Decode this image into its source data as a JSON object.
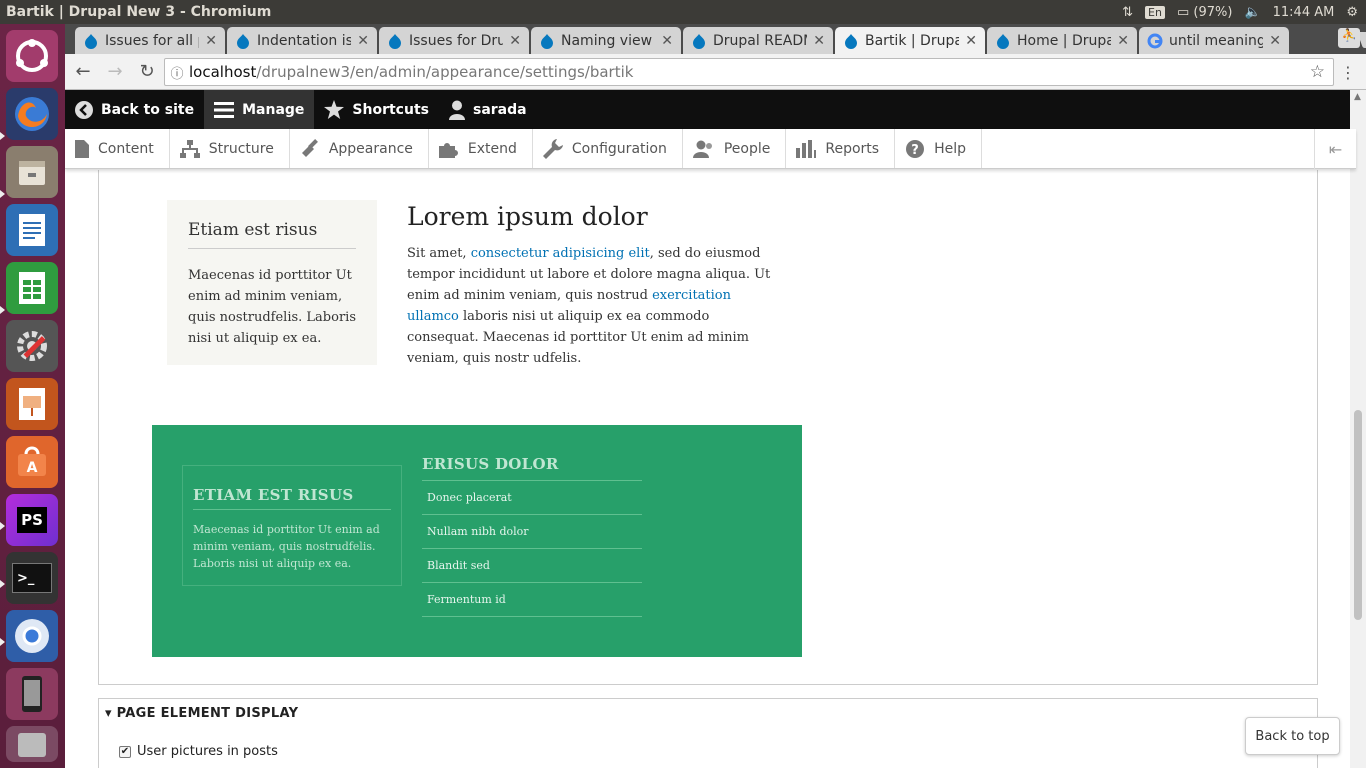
{
  "os_panel": {
    "window_title": "Bartik | Drupal New 3 - Chromium",
    "lang": "En",
    "battery": "(97%)",
    "time": "11:44 AM"
  },
  "launcher": {
    "apps": [
      "ubuntu-dash",
      "firefox",
      "files",
      "libreoffice-writer",
      "libreoffice-calc",
      "system-settings",
      "libreoffice-impress",
      "software-center",
      "phpstorm",
      "terminal",
      "chromium",
      "phone",
      "trash"
    ],
    "phpstorm_label": "PS",
    "terminal_label": ">_"
  },
  "tabs": [
    {
      "title": "Issues for all p",
      "icon": "drupal-icon"
    },
    {
      "title": "Indentation is",
      "icon": "drupal-icon"
    },
    {
      "title": "Issues for Dru",
      "icon": "drupal-icon"
    },
    {
      "title": "Naming view f",
      "icon": "drupal-icon"
    },
    {
      "title": "Drupal READM",
      "icon": "drupal-icon"
    },
    {
      "title": "Bartik | Drupal",
      "icon": "drupal-icon"
    },
    {
      "title": "Home | Drupal",
      "icon": "drupal-icon"
    },
    {
      "title": "until meaning",
      "icon": "google-icon"
    }
  ],
  "address": {
    "host": "localhost",
    "path": "/drupalnew3/en/admin/appearance/settings/bartik"
  },
  "admin_bar": {
    "back": "Back to site",
    "manage": "Manage",
    "shortcuts": "Shortcuts",
    "user": "sarada"
  },
  "admin_tray": [
    "Content",
    "Structure",
    "Appearance",
    "Extend",
    "Configuration",
    "People",
    "Reports",
    "Help"
  ],
  "preview": {
    "sidebar_title": "Etiam est risus",
    "sidebar_text": "Maecenas id porttitor Ut enim ad minim veniam, quis nostrudfelis. Laboris nisi ut aliquip ex ea.",
    "main_title": "Lorem ipsum dolor",
    "main_p1": "Sit amet, ",
    "main_link1": "consectetur adipisicing elit",
    "main_p2": ", sed do eiusmod tempor incididunt ut labore et dolore magna aliqua. Ut enim ad minim veniam, quis nostrud ",
    "main_link2": "exercitation ullamco",
    "main_p3": " laboris nisi ut aliquip ex ea commodo consequat. Maecenas id porttitor Ut enim ad minim veniam, quis nostr udfelis.",
    "footer_block1_title": "ETIAM EST RISUS",
    "footer_block1_text": "Maecenas id porttitor Ut enim ad minim veniam, quis nostrudfelis. Laboris nisi ut aliquip ex ea.",
    "footer_block2_title": "ERISUS DOLOR",
    "footer_links": [
      "Donec placerat",
      "Nullam nibh dolor",
      "Blandit sed",
      "Fermentum id"
    ],
    "footer_color": "#27a06a"
  },
  "fieldset": {
    "legend": "PAGE ELEMENT DISPLAY",
    "checkbox_label": "User pictures in posts",
    "checked": true
  },
  "back_to_top": "Back to top"
}
